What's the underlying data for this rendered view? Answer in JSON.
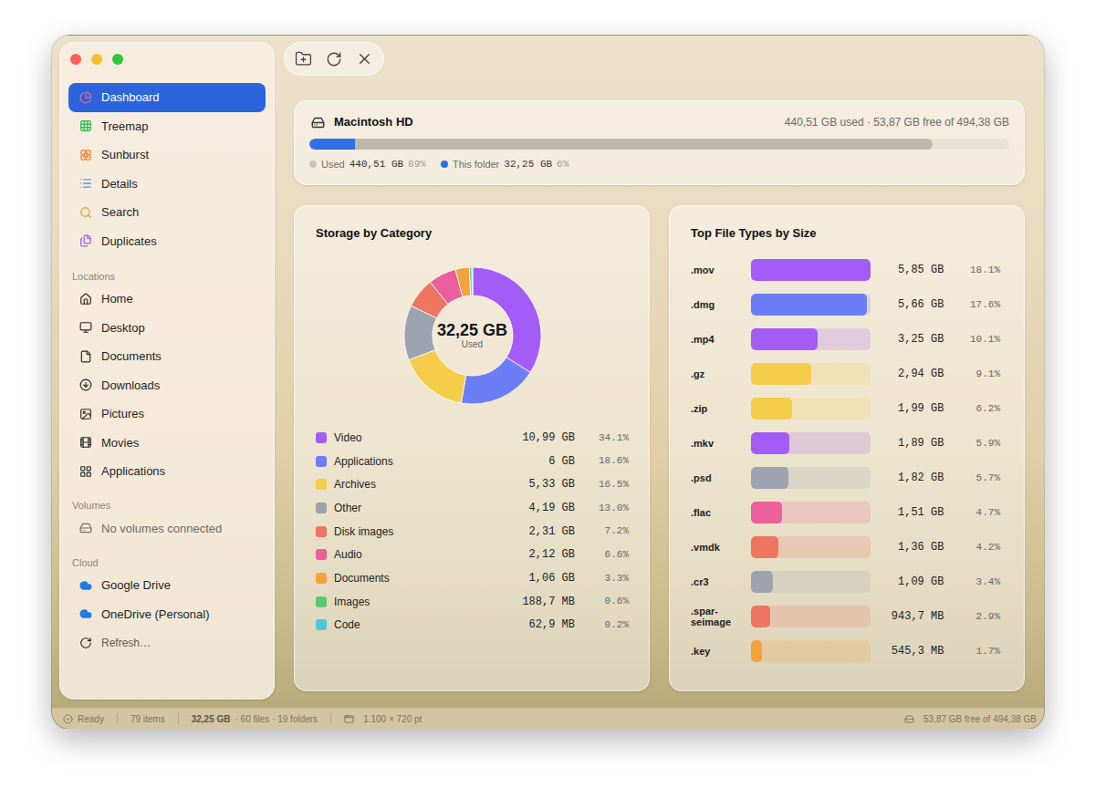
{
  "sidebar": {
    "items": [
      {
        "label": "Dashboard",
        "selected": true
      },
      {
        "label": "Treemap",
        "selected": false
      },
      {
        "label": "Sunburst",
        "selected": false
      },
      {
        "label": "Details",
        "selected": false
      },
      {
        "label": "Search",
        "selected": false
      },
      {
        "label": "Duplicates",
        "selected": false
      }
    ],
    "sections": [
      {
        "title": "Locations",
        "items": [
          {
            "label": "Home",
            "selected": false,
            "kind": "location"
          },
          {
            "label": "Desktop",
            "selected": false,
            "kind": "location"
          },
          {
            "label": "Documents",
            "selected": false,
            "kind": "location"
          },
          {
            "label": "Downloads",
            "selected": false,
            "kind": "location"
          },
          {
            "label": "Pictures",
            "selected": false,
            "kind": "location"
          },
          {
            "label": "Movies",
            "selected": false,
            "kind": "location"
          },
          {
            "label": "Applications",
            "selected": false,
            "kind": "location"
          }
        ]
      },
      {
        "title": "Volumes",
        "items": [
          {
            "label": "No volumes connected",
            "selected": false,
            "kind": "placeholder"
          }
        ]
      },
      {
        "title": "Cloud",
        "items": [
          {
            "label": "Google Drive",
            "selected": false,
            "kind": "location"
          },
          {
            "label": "OneDrive (Personal)",
            "selected": false,
            "kind": "location"
          },
          {
            "label": "Refresh…",
            "selected": false,
            "kind": "action"
          }
        ]
      }
    ]
  },
  "disk": {
    "name": "Macintosh HD",
    "summary": "440,51 GB used · 53,87 GB free of 494,38 GB",
    "used_level": 0.89,
    "folder_level": 0.065,
    "legend": [
      {
        "label": "Used",
        "value": "440,51 GB",
        "percent": "89%",
        "color": "#c9c4bb"
      },
      {
        "label": "This folder",
        "value": "32,25 GB",
        "percent": "6%",
        "color": "#2f6fe4"
      }
    ]
  },
  "category_card": {
    "title": "Storage by Category",
    "center_value": "32,25 GB",
    "center_label": "Used",
    "categories": [
      {
        "name": "Video",
        "size": "10,99 GB",
        "percent": "34.1%",
        "value": 10.99,
        "color": "#a45cf6"
      },
      {
        "name": "Applications",
        "size": "6 GB",
        "percent": "18.6%",
        "value": 6,
        "color": "#6b7ef6"
      },
      {
        "name": "Archives",
        "size": "5,33 GB",
        "percent": "16.5%",
        "value": 5.33,
        "color": "#f5cd4b"
      },
      {
        "name": "Other",
        "size": "4,19 GB",
        "percent": "13.0%",
        "value": 4.19,
        "color": "#9ea3b2"
      },
      {
        "name": "Disk images",
        "size": "2,31 GB",
        "percent": "7.2%",
        "value": 2.31,
        "color": "#ee7560"
      },
      {
        "name": "Audio",
        "size": "2,12 GB",
        "percent": "6.6%",
        "value": 2.12,
        "color": "#ea5f9c"
      },
      {
        "name": "Documents",
        "size": "1,06 GB",
        "percent": "3.3%",
        "value": 1.06,
        "color": "#f3a23c"
      },
      {
        "name": "Images",
        "size": "188,7 MB",
        "percent": "0.6%",
        "value": 0.1887,
        "color": "#5bc96e"
      },
      {
        "name": "Code",
        "size": "62,9 MB",
        "percent": "0.2%",
        "value": 0.0629,
        "color": "#4cc9d6"
      }
    ]
  },
  "file_types_card": {
    "title": "Top File Types by Size",
    "rows": [
      {
        "ext": ".mov",
        "size": "5,85 GB",
        "percent": "18.1%",
        "value": 5.85,
        "level": 1,
        "color": "#a45cf6"
      },
      {
        "ext": ".dmg",
        "size": "5,66 GB",
        "percent": "17.6%",
        "value": 5.66,
        "level": 0.968,
        "color": "#6b7ef6"
      },
      {
        "ext": ".mp4",
        "size": "3,25 GB",
        "percent": "10.1%",
        "value": 3.25,
        "level": 0.556,
        "color": "#a45cf6"
      },
      {
        "ext": ".gz",
        "size": "2,94 GB",
        "percent": "9.1%",
        "value": 2.94,
        "level": 0.503,
        "color": "#f5cd4b"
      },
      {
        "ext": ".zip",
        "size": "1,99 GB",
        "percent": "6.2%",
        "value": 1.99,
        "level": 0.34,
        "color": "#f5cd4b"
      },
      {
        "ext": ".mkv",
        "size": "1,89 GB",
        "percent": "5.9%",
        "value": 1.89,
        "level": 0.323,
        "color": "#a45cf6"
      },
      {
        "ext": ".psd",
        "size": "1,82 GB",
        "percent": "5.7%",
        "value": 1.82,
        "level": 0.311,
        "color": "#9ea3b2"
      },
      {
        "ext": ".flac",
        "size": "1,51 GB",
        "percent": "4.7%",
        "value": 1.51,
        "level": 0.258,
        "color": "#ea5f9c"
      },
      {
        "ext": ".vmdk",
        "size": "1,36 GB",
        "percent": "4.2%",
        "value": 1.36,
        "level": 0.232,
        "color": "#ee7560"
      },
      {
        "ext": ".cr3",
        "size": "1,09 GB",
        "percent": "3.4%",
        "value": 1.09,
        "level": 0.186,
        "color": "#9ea3b2"
      },
      {
        "ext": ".spar-seimage",
        "size": "943,7 MB",
        "percent": "2.9%",
        "value": 0.9437,
        "level": 0.161,
        "color": "#ee7560"
      },
      {
        "ext": ".key",
        "size": "545,3 MB",
        "percent": "1.7%",
        "value": 0.5453,
        "level": 0.093,
        "color": "#f3a23c"
      }
    ]
  },
  "status_bar": {
    "state": "Ready",
    "items": "79 items",
    "size": "32,25 GB",
    "counts": "· 60 files · 19 folders",
    "dimensions": "1.100 × 720 pt",
    "free": "53,87 GB free of 494,38 GB"
  }
}
